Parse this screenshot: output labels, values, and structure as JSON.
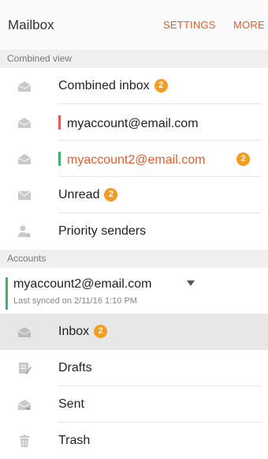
{
  "header": {
    "title": "Mailbox",
    "settings_label": "SETTINGS",
    "more_label": "MORE"
  },
  "sections": {
    "combined_view": "Combined view",
    "accounts": "Accounts"
  },
  "combined": [
    {
      "label": "Combined inbox",
      "badge": "2",
      "icon": "envelope-open-icon"
    },
    {
      "label": "myaccount@email.com",
      "color": "#e35a5a",
      "icon": "envelope-open-icon"
    },
    {
      "label": "myaccount2@email.com",
      "color": "#3db36b",
      "badge": "2",
      "icon": "envelope-open-icon"
    },
    {
      "label": "Unread",
      "badge": "2",
      "icon": "envelope-closed-icon"
    },
    {
      "label": "Priority senders",
      "icon": "person-star-icon"
    }
  ],
  "account": {
    "address": "myaccount2@email.com",
    "last_synced": "Last synced on 2/11/16 1:10 PM",
    "accent": "#3db36b"
  },
  "folders": [
    {
      "label": "Inbox",
      "badge": "2",
      "icon": "inbox-icon"
    },
    {
      "label": "Drafts",
      "icon": "drafts-icon"
    },
    {
      "label": "Sent",
      "icon": "sent-icon"
    },
    {
      "label": "Trash",
      "icon": "trash-icon"
    }
  ],
  "colors": {
    "accent": "#e95b2a",
    "badge": "#f39c1f"
  }
}
